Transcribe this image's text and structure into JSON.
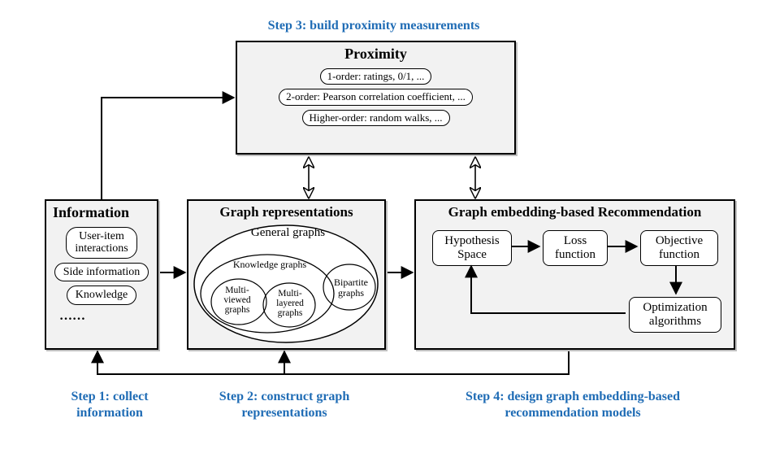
{
  "steps": {
    "s1": "Step 1: collect\ninformation",
    "s2": "Step 2: construct graph\nrepresentations",
    "s3": "Step 3: build proximity measurements",
    "s4": "Step 4: design graph embedding-based\nrecommendation models"
  },
  "information": {
    "title": "Information",
    "items": [
      "User-item\ninteractions",
      "Side information",
      "Knowledge"
    ],
    "ellipsis": "……"
  },
  "graph_reps": {
    "title": "Graph representations",
    "general": "General graphs",
    "knowledge": "Knowledge graphs",
    "multi_viewed": "Multi-\nviewed\ngraphs",
    "multi_layered": "Multi-\nlayered\ngraphs",
    "bipartite": "Bipartite\ngraphs"
  },
  "proximity": {
    "title": "Proximity",
    "p1": "1-order: ratings, 0/1, ...",
    "p2": "2-order: Pearson correlation coefficient, ...",
    "p3": "Higher-order: random walks, ..."
  },
  "recommendation": {
    "title": "Graph embedding-based Recommendation",
    "hyp": "Hypothesis\nSpace",
    "loss": "Loss\nfunction",
    "obj": "Objective\nfunction",
    "opt": "Optimization\nalgorithms"
  },
  "chart_data": {
    "type": "diagram",
    "title": "Graph embedding-based recommendation framework",
    "nodes": [
      {
        "id": "information",
        "label": "Information",
        "items": [
          "User-item interactions",
          "Side information",
          "Knowledge",
          "…"
        ]
      },
      {
        "id": "graph_reps",
        "label": "Graph representations",
        "subgroups": {
          "General graphs": [
            "Knowledge graphs",
            "Multi-viewed graphs",
            "Multi-layered graphs",
            "Bipartite graphs"
          ]
        }
      },
      {
        "id": "proximity",
        "label": "Proximity",
        "items": [
          "1-order: ratings, 0/1, ...",
          "2-order: Pearson correlation coefficient, ...",
          "Higher-order: random walks, ..."
        ]
      },
      {
        "id": "recommendation",
        "label": "Graph embedding-based Recommendation",
        "items": [
          "Hypothesis Space",
          "Loss function",
          "Objective function",
          "Optimization algorithms"
        ]
      }
    ],
    "edges": [
      {
        "from": "information",
        "to": "graph_reps",
        "style": "solid-arrow"
      },
      {
        "from": "information",
        "to": "proximity",
        "style": "solid-arrow"
      },
      {
        "from": "graph_reps",
        "to": "recommendation",
        "style": "solid-arrow"
      },
      {
        "from": "graph_reps",
        "to": "proximity",
        "style": "double-open-arrow"
      },
      {
        "from": "recommendation",
        "to": "proximity",
        "style": "double-open-arrow"
      },
      {
        "from": "recommendation",
        "to": "information",
        "style": "feedback-arrow"
      },
      {
        "from": "recommendation",
        "to": "graph_reps",
        "style": "feedback-arrow"
      },
      {
        "from": "recommendation.hyp",
        "to": "recommendation.loss",
        "style": "solid-arrow"
      },
      {
        "from": "recommendation.loss",
        "to": "recommendation.obj",
        "style": "solid-arrow"
      },
      {
        "from": "recommendation.obj",
        "to": "recommendation.opt",
        "style": "solid-arrow"
      },
      {
        "from": "recommendation.opt",
        "to": "recommendation.hyp",
        "style": "feedback-arrow"
      }
    ],
    "step_labels": {
      "Step 1": "collect information",
      "Step 2": "construct graph representations",
      "Step 3": "build proximity measurements",
      "Step 4": "design graph embedding-based recommendation models"
    }
  }
}
